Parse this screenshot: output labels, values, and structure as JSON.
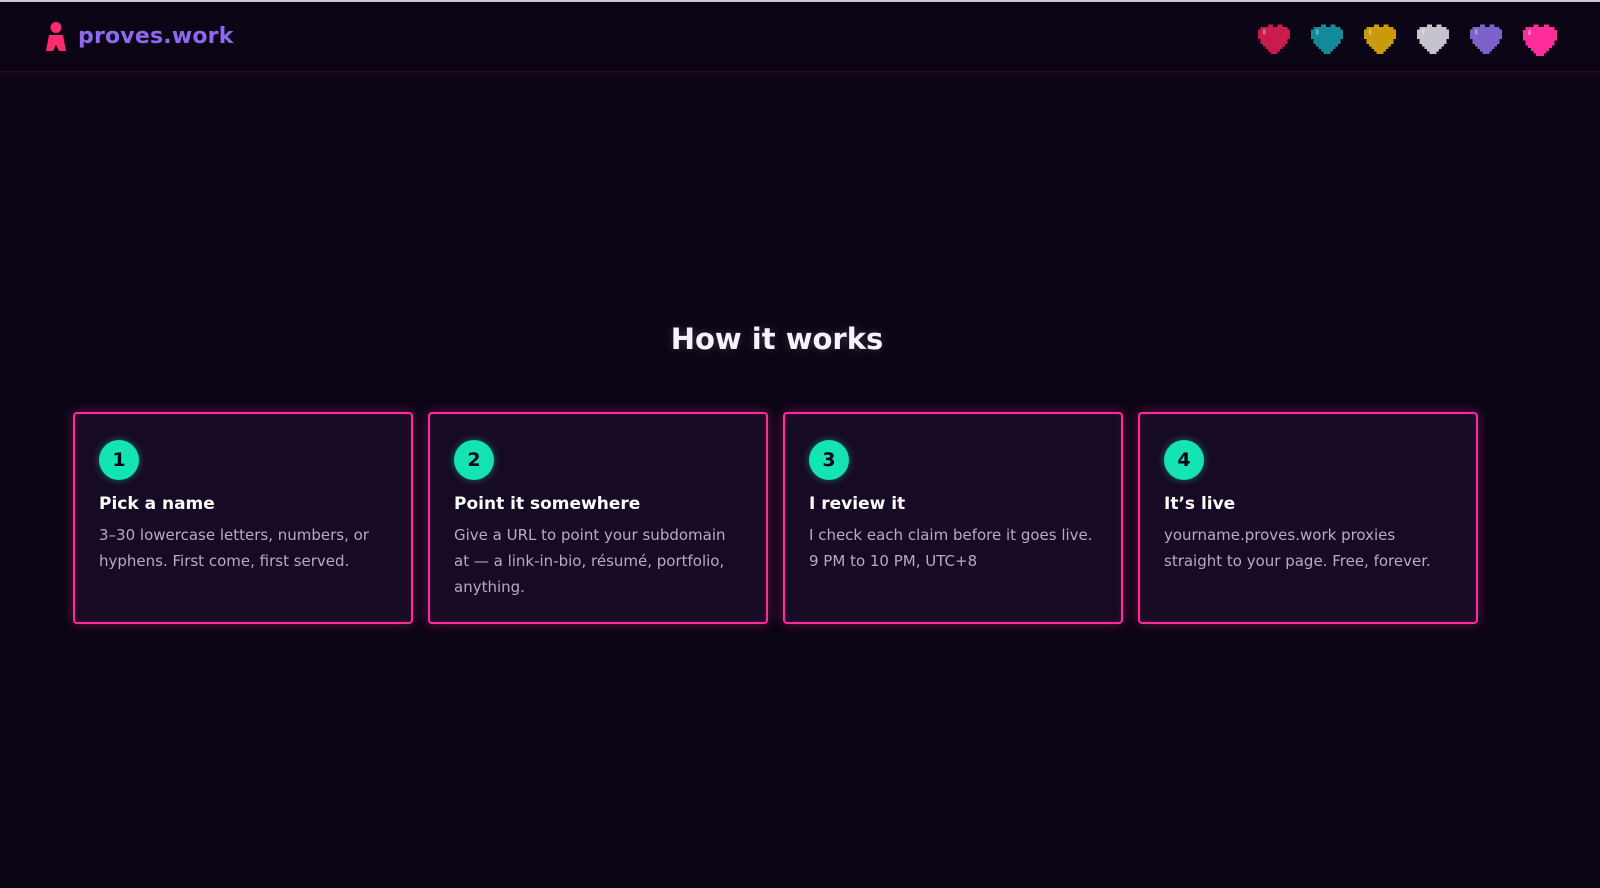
{
  "brand": {
    "name": "proves.work",
    "logo_icon": "person-pin-icon",
    "accent": "#ff2d6f",
    "name_color": "#8f68f0"
  },
  "hearts": [
    {
      "name": "heart-crimson",
      "color": "#c81c4c"
    },
    {
      "name": "heart-teal",
      "color": "#138a9c"
    },
    {
      "name": "heart-gold",
      "color": "#c99a0c"
    },
    {
      "name": "heart-silver",
      "color": "#c7c3cc"
    },
    {
      "name": "heart-lavender",
      "color": "#7d62c8"
    },
    {
      "name": "heart-pink",
      "color": "#ff2d9c"
    }
  ],
  "section": {
    "title": "How it works"
  },
  "steps": [
    {
      "number": "1",
      "title": "Pick a name",
      "text": "3–30 lowercase letters, numbers, or hyphens. First come, first served."
    },
    {
      "number": "2",
      "title": "Point it somewhere",
      "text": "Give a URL to point your subdomain at — a link-in-bio, résumé, portfolio, anything."
    },
    {
      "number": "3",
      "title": "I review it",
      "text": "I check each claim before it goes live. 9 PM to 10 PM, UTC+8"
    },
    {
      "number": "4",
      "title": "It’s live",
      "text": "yourname.proves.work proxies straight to your page. Free, forever."
    }
  ],
  "colors": {
    "background": "#0b0515",
    "card_border": "#ff2d9c",
    "badge": "#14e3b3"
  }
}
